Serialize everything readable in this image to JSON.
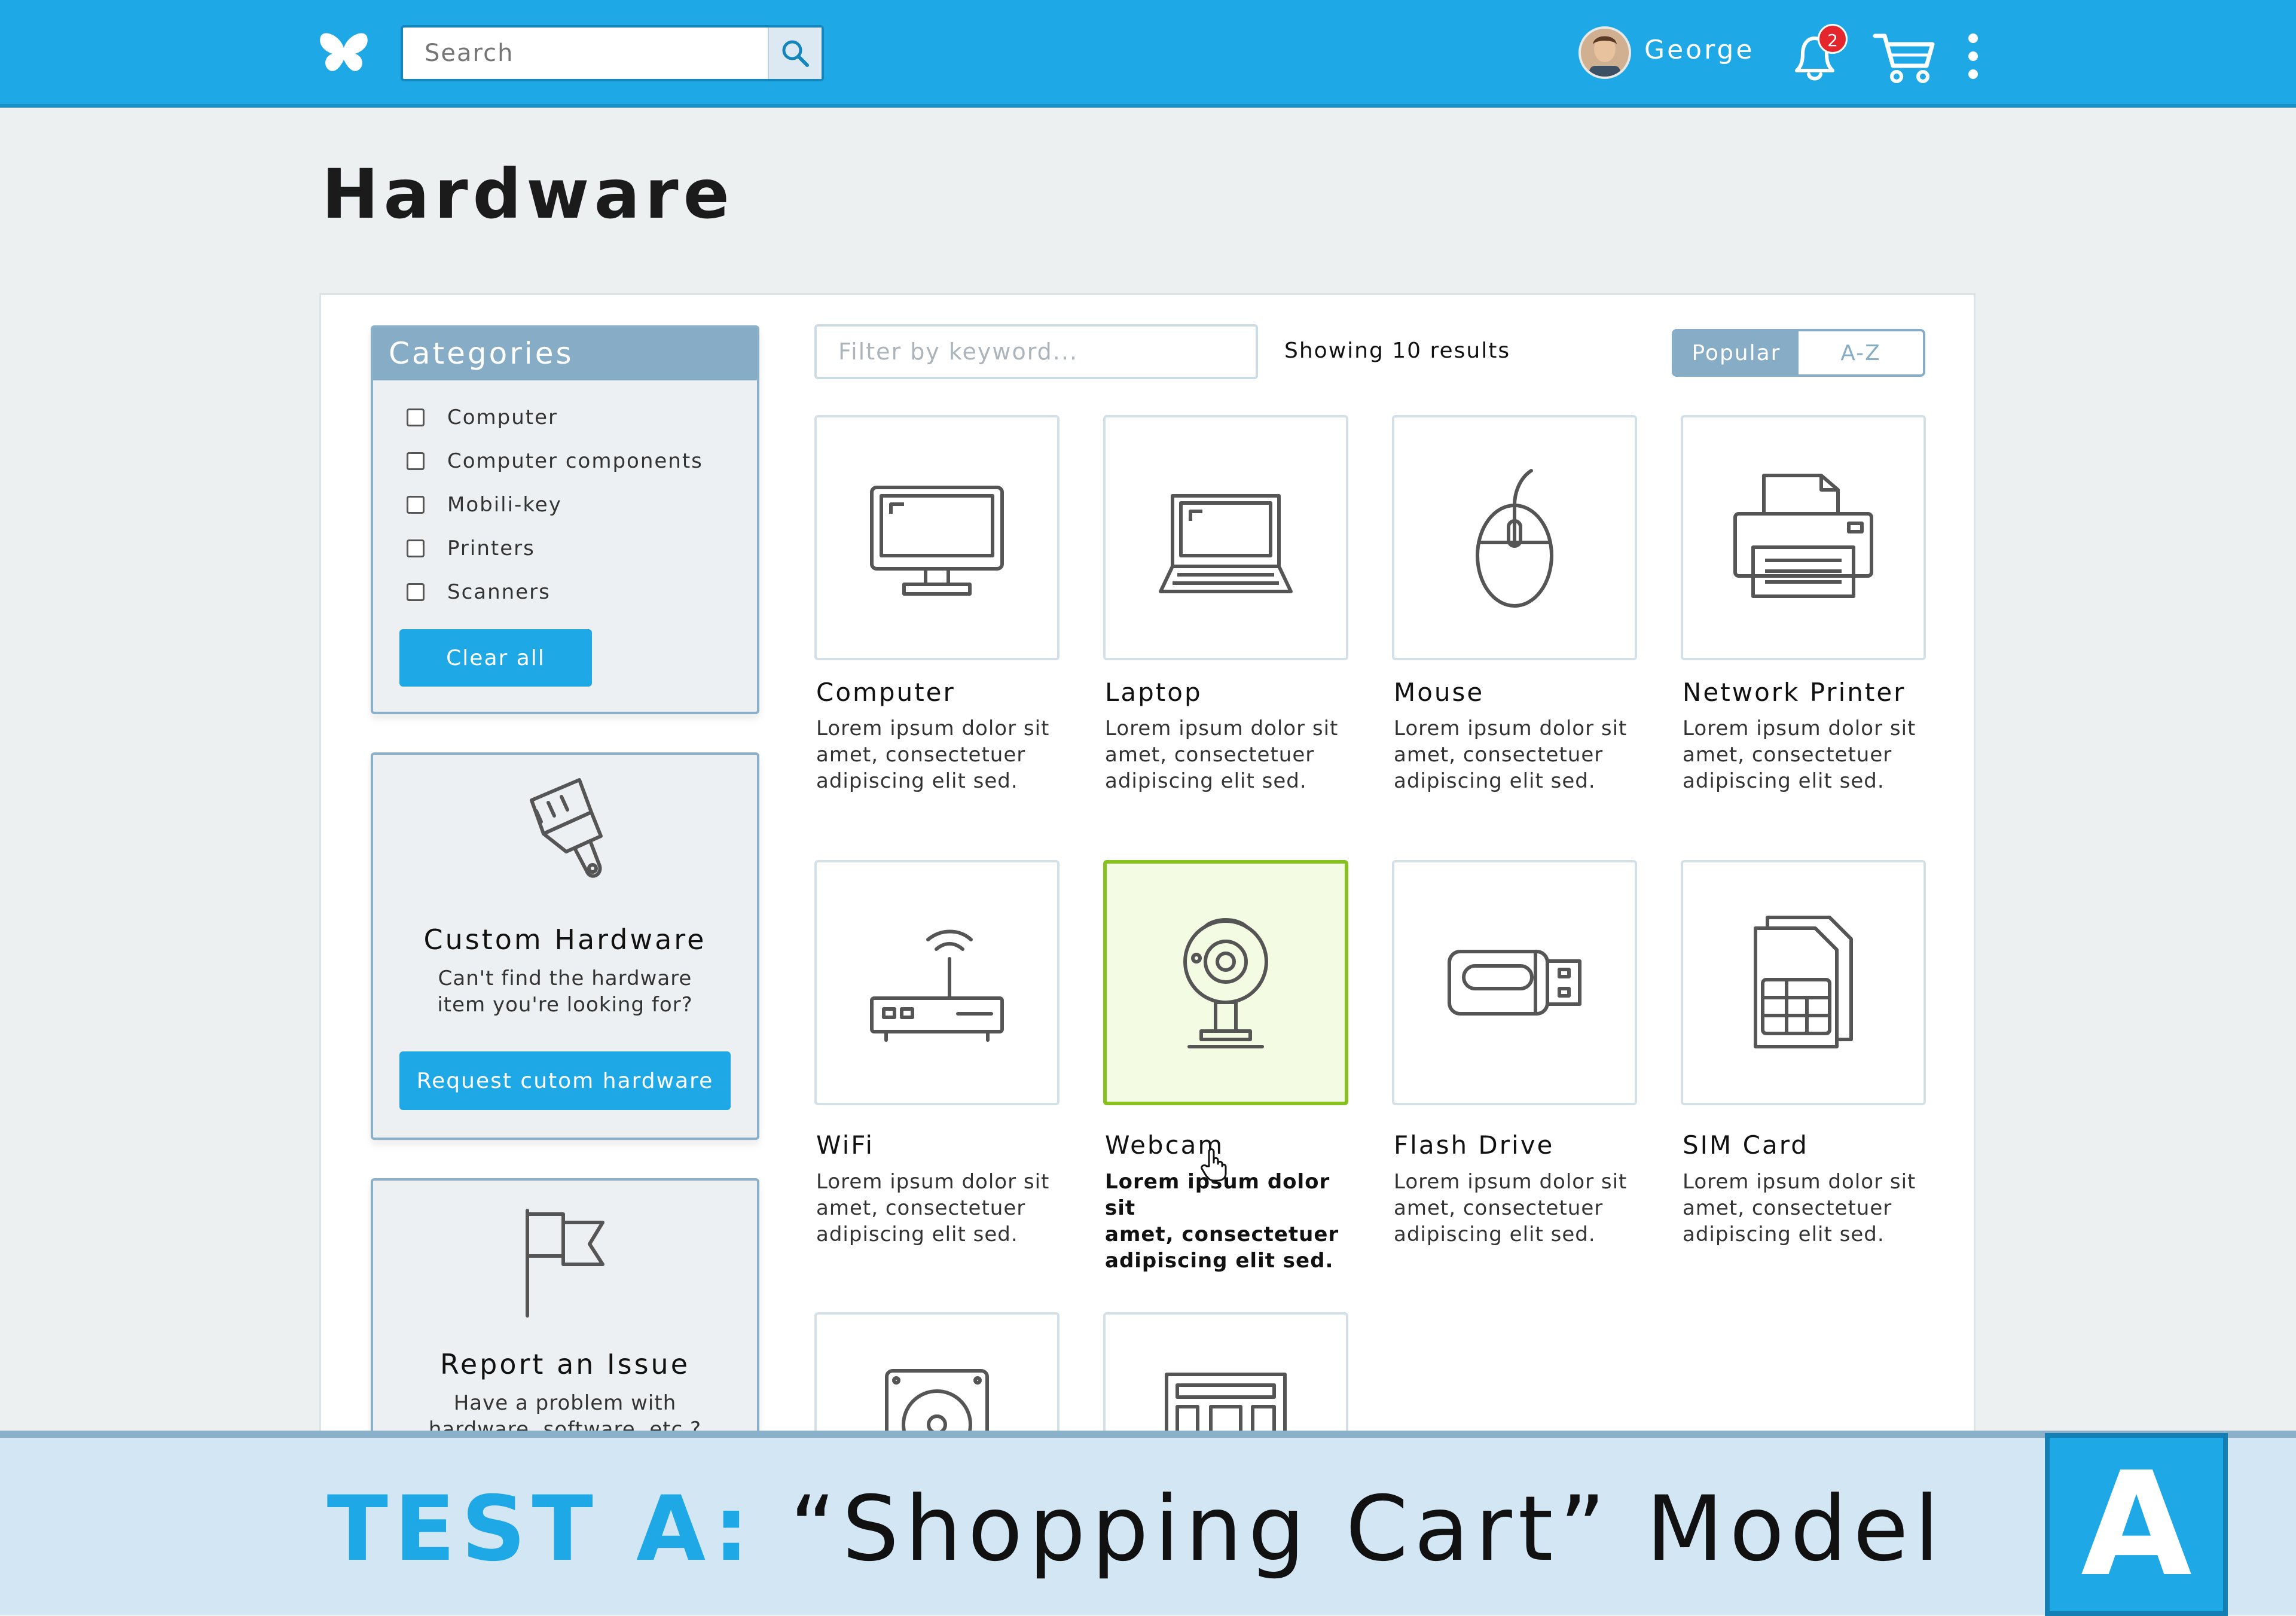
{
  "header": {
    "search_placeholder": "Search",
    "username": "George",
    "notification_count": "2",
    "icons": [
      "butterfly-logo-icon",
      "search-icon",
      "avatar",
      "bell-icon",
      "cart-icon",
      "kebab-menu-icon"
    ]
  },
  "page": {
    "title": "Hardware"
  },
  "categories": {
    "title": "Categories",
    "items": [
      "Computer",
      "Computer components",
      "Mobili-key",
      "Printers",
      "Scanners"
    ],
    "clear_label": "Clear all"
  },
  "custom_hardware": {
    "title": "Custom Hardware",
    "text_line1": "Can't find the hardware",
    "text_line2": "item you're looking for?",
    "button_label": "Request cutom hardware"
  },
  "report_issue": {
    "title": "Report an Issue",
    "text_line1": "Have a problem with",
    "text_line2": "hardware, software, etc.?"
  },
  "toolbar": {
    "filter_placeholder": "Filter by keyword...",
    "results_text": "Showing 10 results",
    "sort_popular": "Popular",
    "sort_az": "A-Z"
  },
  "products": [
    {
      "name": "Computer",
      "desc": [
        "Lorem ipsum dolor sit",
        "amet, consectetuer",
        "adipiscing elit sed."
      ]
    },
    {
      "name": "Laptop",
      "desc": [
        "Lorem ipsum dolor sit",
        "amet, consectetuer",
        "adipiscing elit sed."
      ]
    },
    {
      "name": "Mouse",
      "desc": [
        "Lorem ipsum dolor sit",
        "amet, consectetuer",
        "adipiscing elit sed."
      ]
    },
    {
      "name": "Network Printer",
      "desc": [
        "Lorem ipsum dolor sit",
        "amet, consectetuer",
        "adipiscing elit sed."
      ]
    },
    {
      "name": "WiFi",
      "desc": [
        "Lorem ipsum dolor sit",
        "amet, consectetuer",
        "adipiscing elit sed."
      ]
    },
    {
      "name": "Webcam",
      "desc": [
        "Lorem ipsum dolor sit",
        "amet, consectetuer",
        "adipiscing elit sed."
      ]
    },
    {
      "name": "Flash Drive",
      "desc": [
        "Lorem ipsum dolor sit",
        "amet, consectetuer",
        "adipiscing elit sed."
      ]
    },
    {
      "name": "SIM Card",
      "desc": [
        "Lorem ipsum dolor sit",
        "amet, consectetuer",
        "adipiscing elit sed."
      ]
    }
  ],
  "banner": {
    "lead": "TEST A:",
    "rest": " “Shopping Cart” Model",
    "letter": "A"
  },
  "colors": {
    "brand": "#1ea8e6",
    "panel_accent": "#86acc6",
    "selected_border": "#86c11f",
    "selected_bg": "#f4fbe3",
    "badge": "#e6262d"
  }
}
